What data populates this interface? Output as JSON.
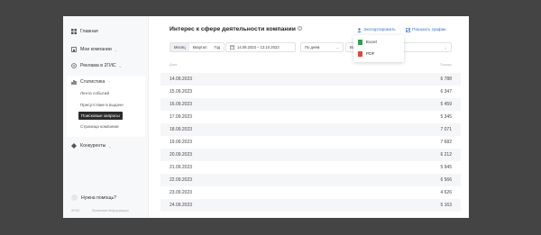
{
  "sidebar": {
    "items": [
      {
        "label": "Главная",
        "icon": "grid-icon",
        "has_chevron": false
      },
      {
        "label": "Мои компании",
        "icon": "building-icon",
        "has_chevron": true
      },
      {
        "label": "Реклама в 2ГИС",
        "icon": "megaphone-icon",
        "has_chevron": true
      },
      {
        "label": "Статистика",
        "icon": "chart-icon",
        "has_chevron": true
      },
      {
        "label": "Конкуренты",
        "icon": "diamond-icon",
        "has_chevron": true
      }
    ],
    "sub_items": [
      {
        "label": "Лента событий",
        "active": false
      },
      {
        "label": "Присутствие в выдаче",
        "active": false
      },
      {
        "label": "Поисковые запросы",
        "active": true
      },
      {
        "label": "Страница компании",
        "active": false
      }
    ],
    "help_label": "Нужна помощь?",
    "footer": [
      "2ГИС",
      "Правовая информация"
    ]
  },
  "main": {
    "title": "Интерес к сфере деятельности компании",
    "export_label": "Экспортировать",
    "chart_link_label": "Показать график",
    "period_tabs": [
      {
        "label": "Месяц",
        "selected": true
      },
      {
        "label": "Квартал",
        "selected": false
      },
      {
        "label": "Год",
        "selected": false
      }
    ],
    "date_range": "14.09.2023 – 13.10.2023",
    "group_by": "По дням",
    "second_select": "Вс",
    "export_menu": [
      {
        "label": "Excel",
        "color": "#2e9e4f"
      },
      {
        "label": "PDF",
        "color": "#e0463a"
      }
    ],
    "table": {
      "col_date": "Дата",
      "col_value": "Показы",
      "rows": [
        {
          "date": "14.09.2023",
          "value": "6 788"
        },
        {
          "date": "15.09.2023",
          "value": "6 347"
        },
        {
          "date": "16.09.2023",
          "value": "5 459"
        },
        {
          "date": "17.09.2023",
          "value": "5 345"
        },
        {
          "date": "18.09.2023",
          "value": "7 071"
        },
        {
          "date": "19.09.2023",
          "value": "7 682"
        },
        {
          "date": "20.09.2023",
          "value": "6 212"
        },
        {
          "date": "21.09.2023",
          "value": "5 945"
        },
        {
          "date": "22.09.2023",
          "value": "6 566"
        },
        {
          "date": "23.09.2023",
          "value": "4 626"
        },
        {
          "date": "24.09.2023",
          "value": "5 163"
        }
      ]
    }
  }
}
